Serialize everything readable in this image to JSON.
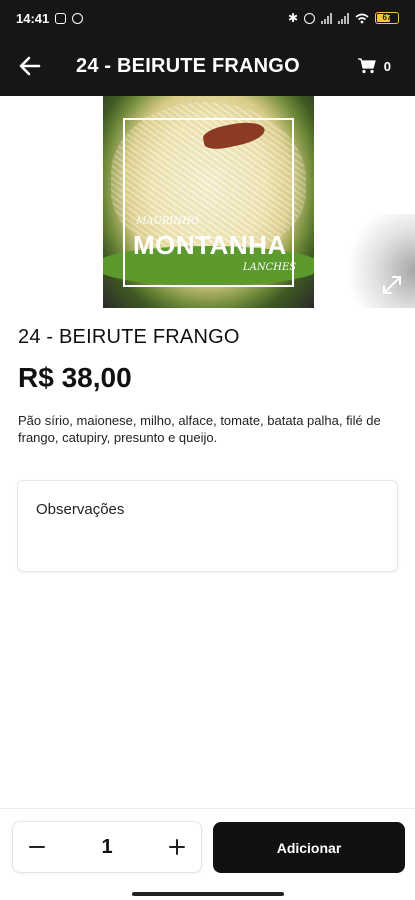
{
  "status_bar": {
    "time": "14:41",
    "battery": "67"
  },
  "app_bar": {
    "title": "24 - BEIRUTE FRANGO",
    "back_icon": "arrow-left-icon",
    "cart_icon": "cart-icon",
    "cart_count": "0"
  },
  "product": {
    "image_logo_top": "MAURINHO",
    "image_logo_main": "MONTANHA",
    "image_logo_sub": "LANCHES",
    "expand_icon": "expand-icon",
    "name": "24 - BEIRUTE FRANGO",
    "price": "R$ 38,00",
    "description": "Pão sírio, maionese, milho, alface, tomate, batata palha, filé de frango, catupiry, presunto e queijo."
  },
  "notes": {
    "placeholder": "Observações"
  },
  "order": {
    "quantity": "1",
    "minus_icon": "minus-icon",
    "plus_icon": "plus-icon",
    "add_label": "Adicionar"
  },
  "colors": {
    "bar_background": "#161616",
    "button_background": "#111111",
    "battery": "#f5c542"
  }
}
